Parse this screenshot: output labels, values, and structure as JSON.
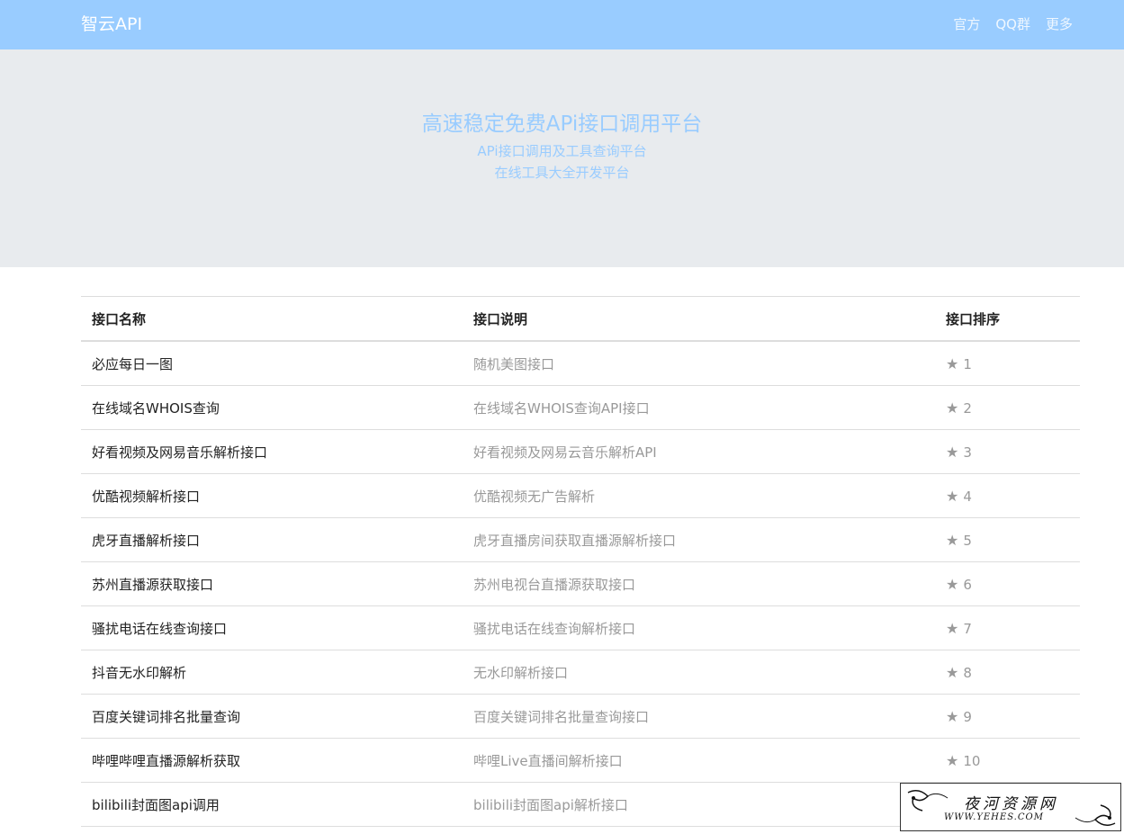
{
  "navbar": {
    "brand": "智云API",
    "links": [
      "官方",
      "QQ群",
      "更多"
    ]
  },
  "hero": {
    "title": "高速稳定免费APi接口调用平台",
    "subtitle1": "APi接口调用及工具查询平台",
    "subtitle2": "在线工具大全开发平台"
  },
  "table": {
    "headers": [
      "接口名称",
      "接口说明",
      "接口排序"
    ],
    "rows": [
      {
        "name": "必应每日一图",
        "desc": "随机美图接口",
        "rank": "1"
      },
      {
        "name": "在线域名WHOIS查询",
        "desc": "在线域名WHOIS查询API接口",
        "rank": "2"
      },
      {
        "name": "好看视频及网易音乐解析接口",
        "desc": "好看视频及网易云音乐解析API",
        "rank": "3"
      },
      {
        "name": "优酷视频解析接口",
        "desc": "优酷视频无广告解析",
        "rank": "4"
      },
      {
        "name": "虎牙直播解析接口",
        "desc": "虎牙直播房间获取直播源解析接口",
        "rank": "5"
      },
      {
        "name": "苏州直播源获取接口",
        "desc": "苏州电视台直播源获取接口",
        "rank": "6"
      },
      {
        "name": "骚扰电话在线查询接口",
        "desc": "骚扰电话在线查询解析接口",
        "rank": "7"
      },
      {
        "name": "抖音无水印解析",
        "desc": "无水印解析接口",
        "rank": "8"
      },
      {
        "name": "百度关键词排名批量查询",
        "desc": "百度关键词排名批量查询接口",
        "rank": "9"
      },
      {
        "name": "哔哩哔哩直播源解析获取",
        "desc": "哔哩Live直播间解析接口",
        "rank": "10"
      },
      {
        "name": "bilibili封面图api调用",
        "desc": "bilibili封面图api解析接口",
        "rank": ""
      }
    ]
  },
  "watermark": {
    "title": "夜河资源网",
    "url": "WWW.YEHES.COM"
  },
  "icons": {
    "rank": "star-icon"
  },
  "colors": {
    "navbar": "#99ccff",
    "hero_bg": "#e8ebee",
    "hero_text": "#99ccff",
    "muted_text": "#999999"
  }
}
